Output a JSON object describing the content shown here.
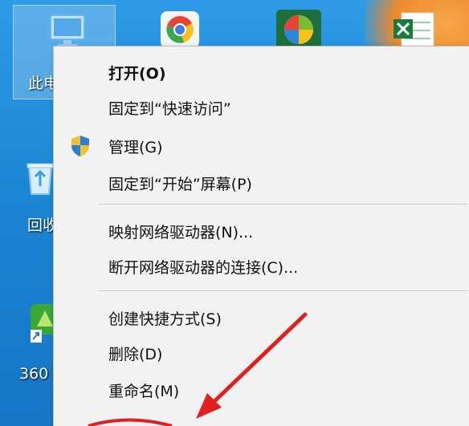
{
  "desktop": {
    "icons": [
      {
        "label": "此电",
        "icon": "this-pc-icon"
      },
      {
        "label": "回收",
        "icon": "recycle-bin-icon"
      },
      {
        "label": "360",
        "icon": "shortcut-360-icon"
      }
    ],
    "top_icons": [
      "chrome-app-icon",
      "microsoft-store-icon",
      "excel-icon"
    ]
  },
  "context_menu": {
    "items": [
      {
        "label": "打开(O)",
        "bold": true
      },
      {
        "label": "固定到“快速访问”"
      },
      {
        "label": "管理(G)",
        "icon": "uac-shield-icon"
      },
      {
        "label": "固定到“开始”屏幕(P)"
      },
      {
        "label": "映射网络驱动器(N)..."
      },
      {
        "label": "断开网络驱动器的连接(C)..."
      },
      {
        "label": "创建快捷方式(S)"
      },
      {
        "label": "删除(D)"
      },
      {
        "label": "重命名(M)"
      }
    ]
  },
  "colors": {
    "desktop": "#1e8ad6",
    "menu_bg": "#f2f2f2",
    "annotation_arrow": "#e02020"
  }
}
